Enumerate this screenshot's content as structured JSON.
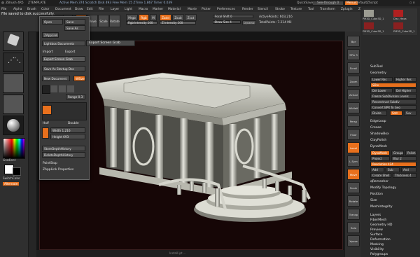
{
  "title": {
    "app": "ZBrush 4R5",
    "doc": "ZTEMPLATE",
    "stats": "Active Mem 374  Scratch Disk 493  Free Mem 15  ZTime 1.867  Timer 0.039",
    "quicksave": "QuickSave",
    "seethrough": "See-through 0",
    "menus_label": "Menus",
    "script": "DefaultZScript"
  },
  "menu": [
    "File",
    "Alpha",
    "Brush",
    "Color",
    "Document",
    "Draw",
    "Edit",
    "File",
    "Layer",
    "Light",
    "Macro",
    "Marker",
    "Material",
    "Movie",
    "Picker",
    "Preferences",
    "Render",
    "Stencil",
    "Stroke",
    "Texture",
    "Tool",
    "Transform",
    "Zplugin",
    "Zscript"
  ],
  "shelf": {
    "draw": "Draw",
    "move": "Move",
    "scale": "Scale",
    "rotate": "Rotate",
    "mrgb": "Mrgb",
    "rgb": "Rgb",
    "m": "M",
    "rgb_intensity": "Rgb Intensity 100",
    "zadd": "Zadd",
    "zsub": "Zsub",
    "zcut": "Zcut",
    "z_intensity": "Z Intensity 100",
    "focal_shift": "Focal Shift 0",
    "draw_size": "Draw Size 4",
    "dynamic": "Dynamic",
    "active_points": "ActivePoints: 603,216",
    "total_points": "TotalPoints: 7.214 Mil"
  },
  "popup": {
    "header": "File saved to disk successfully.",
    "open": "Open",
    "save": "Save",
    "save_as": "Save As",
    "zapplink": "ZAppLink",
    "lightbox_documents": "Lightbox Documents",
    "import": "Import",
    "export": "Export",
    "export_screen_grab": "Export Screen Grab",
    "save_startup_doc": "Save As Startup Doc",
    "new_document": "New Document",
    "wsize": "WSize",
    "range": "Range 0.3",
    "half": "Half",
    "double": "Double",
    "width": "Width 1,216",
    "height": "Height 693",
    "store_depth": "StoreDepthHistory",
    "delete_depth": "DeleteDepthHistory",
    "paintstop": "PaintStop",
    "zapplink_properties": "ZAppLink Properties"
  },
  "tooltip": "Export Screen Grab",
  "left": {
    "gradient": "Gradient",
    "switch_color": "SwitchColor",
    "alternate": "Alternate"
  },
  "right_tray": [
    "Bpr",
    "SPix 3",
    "Scroll",
    "Zoom",
    "Actual",
    "AAHalf",
    "Persp",
    "Floor",
    "Local",
    "L.Sym",
    "Move",
    "Scale",
    "Rotate",
    "Transp",
    "Solo",
    "Xpose"
  ],
  "palette": {
    "subtools": [
      "PM3D_Cube3D_1",
      "Disc_Hexa",
      "PM3D_Cube3D_1",
      "PM3D_Cube3D_1"
    ],
    "subtool_label": "SubTool",
    "geometry": "Geometry",
    "lower_res": "Lower Res",
    "higher_res": "Higher Res",
    "sdiv": "SDiv",
    "del_lower": "Del Lower",
    "del_higher": "Del Higher",
    "freeze": "Freeze SubDivision Levels",
    "reconstruct": "Reconstruct Subdiv",
    "convert_bpr": "Convert BPR To Geo",
    "divide": "Divide",
    "smt": "Smt",
    "suv": "Suv",
    "edge_loop": "EdgeLoop",
    "crease": "Crease",
    "shadow_box": "ShadowBox",
    "clay_polish": "ClayPolish",
    "dynamesh": "DynaMesh",
    "groups": "Groups",
    "polish": "Polish",
    "blur": "Blur 2",
    "project": "Project",
    "resolution": "Resolution 424",
    "add": "Add",
    "sub": "Sub",
    "and": "And",
    "create_shell": "Create Shell",
    "thickness": "Thickness 4",
    "qremesher": "qRemesher",
    "modify_topology": "Modify Topology",
    "position": "Position",
    "size": "Size",
    "mesh_integrity": "MeshIntegrity",
    "sections": [
      "Layers",
      "FiberMesh",
      "Geometry HD",
      "Preview",
      "Surface",
      "Deformation",
      "Masking",
      "Visibility",
      "Polygroups"
    ]
  },
  "status": "Install ipt ..."
}
